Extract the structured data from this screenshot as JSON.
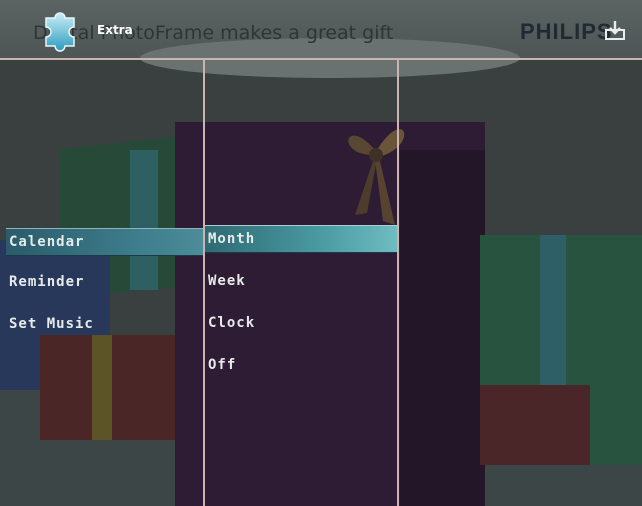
{
  "header": {
    "caption": "Digital PhotoFrame makes a great gift",
    "brand": "PHILIPS",
    "mode_title": "Extra",
    "logo_icon": "puzzle-gear-icon",
    "brand_icon": "import-icon"
  },
  "left_menu": {
    "items": [
      {
        "label": "Calendar",
        "selected": true
      },
      {
        "label": "Reminder",
        "selected": false
      },
      {
        "label": "Set Music",
        "selected": false
      }
    ]
  },
  "right_menu": {
    "items": [
      {
        "label": "Month",
        "selected": true
      },
      {
        "label": "Week",
        "selected": false
      },
      {
        "label": "Clock",
        "selected": false
      },
      {
        "label": "Off",
        "selected": false
      }
    ]
  },
  "colors": {
    "selection": "#3f7f8e",
    "divider": "#c9b4b1",
    "menu_text": "#e6ebea"
  }
}
